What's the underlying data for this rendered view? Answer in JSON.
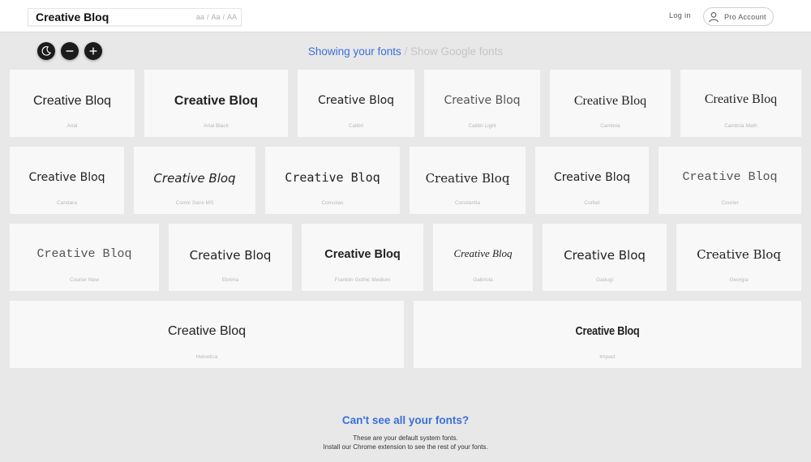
{
  "header": {
    "preview_text": "Creative Bloq",
    "case_options": [
      "aa",
      "Aa",
      "AA"
    ],
    "case_separator": "/",
    "login_label": "Log in",
    "pro_label": "Pro Account"
  },
  "controls": {
    "icons": [
      "moon-icon",
      "minus-icon",
      "plus-icon"
    ]
  },
  "source_toggle": {
    "active": "Showing your fonts",
    "separator": " / ",
    "inactive": "Show Google fonts"
  },
  "fonts": [
    {
      "sample": "Creative Bloq",
      "name": "Arial"
    },
    {
      "sample": "Creative Bloq",
      "name": "Arial Black"
    },
    {
      "sample": "Creative Bloq",
      "name": "Calibri"
    },
    {
      "sample": "Creative Bloq",
      "name": "Calibri Light"
    },
    {
      "sample": "Creative Bloq",
      "name": "Cambria"
    },
    {
      "sample": "Creative Bloq",
      "name": "Cambria Math"
    },
    {
      "sample": "Creative Bloq",
      "name": "Candara"
    },
    {
      "sample": "Creative Bloq",
      "name": "Comic Sans MS"
    },
    {
      "sample": "Creative Bloq",
      "name": "Consolas"
    },
    {
      "sample": "Creative Bloq",
      "name": "Constantia"
    },
    {
      "sample": "Creative Bloq",
      "name": "Corbel"
    },
    {
      "sample": "Creative Bloq",
      "name": "Courier"
    },
    {
      "sample": "Creative Bloq",
      "name": "Courier New"
    },
    {
      "sample": "Creative Bloq",
      "name": "Ebrima"
    },
    {
      "sample": "Creative Bloq",
      "name": "Franklin Gothic Medium"
    },
    {
      "sample": "Creative Bloq",
      "name": "Gabriola"
    },
    {
      "sample": "Creative Bloq",
      "name": "Gadugi"
    },
    {
      "sample": "Creative Bloq",
      "name": "Georgia"
    },
    {
      "sample": "Creative Bloq",
      "name": "Helvetica"
    },
    {
      "sample": "Creative Bloq",
      "name": "Impact"
    }
  ],
  "help": {
    "title": "Can't see all your fonts?",
    "line1": "These are your default system fonts.",
    "line2": "Install our Chrome extension to see the rest of your fonts."
  },
  "colors": {
    "accent": "#3a6fd8",
    "background": "#e8e8e8",
    "card": "#f8f8f8"
  }
}
